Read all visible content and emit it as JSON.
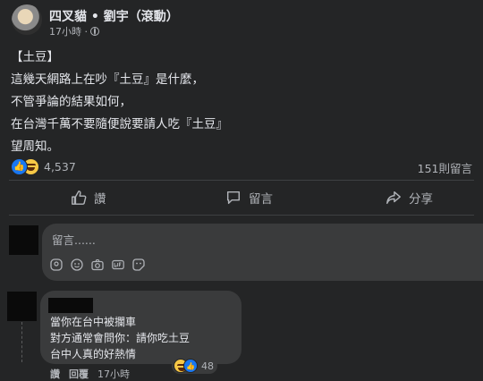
{
  "post": {
    "author": "四叉貓 • 劉宇（滾動）",
    "time": "17小時 ·",
    "lines": [
      "【土豆】",
      "這幾天網路上在吵『土豆』是什麼，",
      "不管爭論的結果如何，",
      "在台灣千萬不要隨便說要請人吃『土豆』",
      "望周知。"
    ]
  },
  "stats": {
    "reaction_count": "4,537",
    "comment_count": "151則留言"
  },
  "actions": {
    "like": "讚",
    "comment": "留言",
    "share": "分享"
  },
  "composer": {
    "placeholder": "留言......"
  },
  "comment": {
    "lines": [
      "當你在台中被攔車",
      "對方通常會問你：請你吃土豆",
      "台中人真的好熱情"
    ],
    "reaction_count": "48",
    "like_label": "讚",
    "reply_label": "回覆",
    "time": "17小時"
  }
}
